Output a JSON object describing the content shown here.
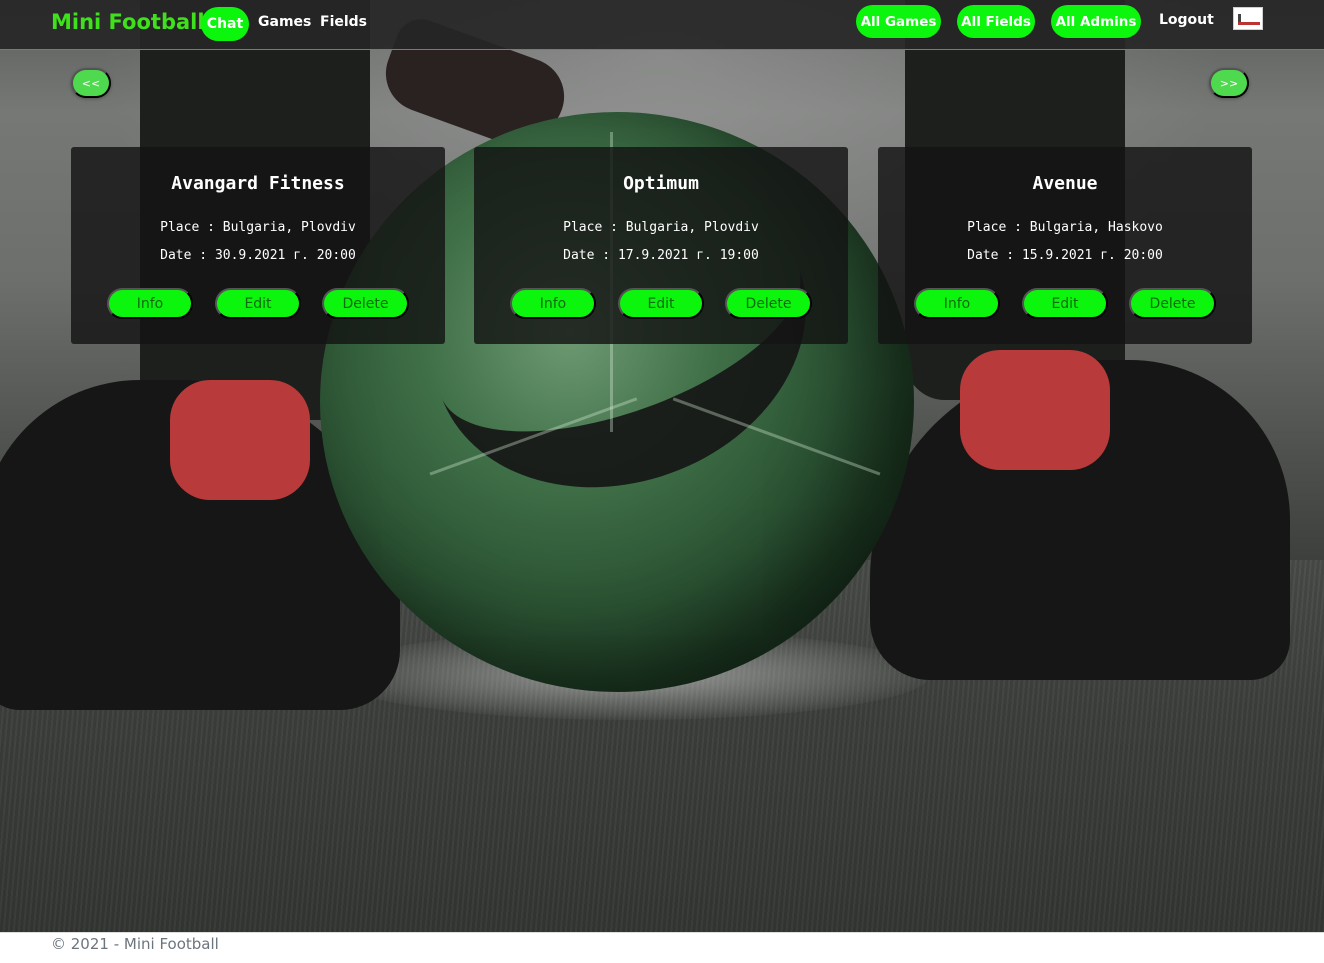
{
  "navbar": {
    "brand": "Mini Football",
    "links": {
      "chat": "Chat",
      "games": "Games",
      "fields": "Fields"
    },
    "admin": {
      "all_games": "All Games",
      "all_fields": "All Fields",
      "all_admins": "All Admins",
      "logout": "Logout"
    },
    "colors": {
      "accent": "#0cf50c",
      "brand": "#3ee11b"
    }
  },
  "carousel": {
    "prev_label": "<<",
    "next_label": ">>"
  },
  "cards": [
    {
      "title": "Avangard Fitness",
      "place": "Place : Bulgaria, Plovdiv",
      "date": "Date : 30.9.2021 г. 20:00",
      "info": "Info",
      "edit": "Edit",
      "delete": "Delete"
    },
    {
      "title": "Optimum",
      "place": "Place : Bulgaria, Plovdiv",
      "date": "Date : 17.9.2021 г. 19:00",
      "info": "Info",
      "edit": "Edit",
      "delete": "Delete"
    },
    {
      "title": "Avenue",
      "place": "Place : Bulgaria, Haskovo",
      "date": "Date : 15.9.2021 г. 20:00",
      "info": "Info",
      "edit": "Edit",
      "delete": "Delete"
    }
  ],
  "footer": {
    "text": "© 2021 - Mini Football"
  },
  "icons": {
    "avatar": "user-avatar-icon",
    "background": "football-background"
  }
}
